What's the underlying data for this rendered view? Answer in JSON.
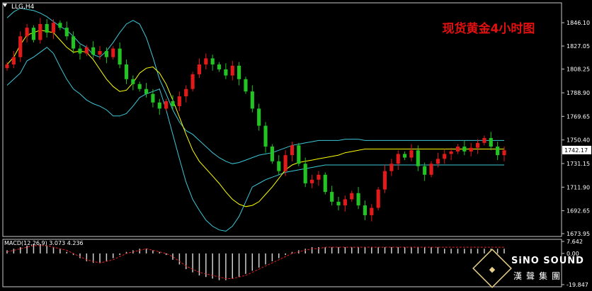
{
  "symbol_label": "LLG,H4",
  "chart_title": "现货黄金4小时图",
  "current_price": "1742.17",
  "indicator_label": "MACD(12,26,9) 3.073 4.236",
  "watermark": {
    "brand": "SiNO SOUND",
    "sub": "漢聲集團"
  },
  "colors": {
    "background": "#000000",
    "up_candle": "#e21a1a",
    "down_candle": "#22c322",
    "bands": "#3cc7d8",
    "middle_line": "#ffff00",
    "macd_hist": "#d0d0d0",
    "macd_signal": "#e02020",
    "title": "#e01010"
  },
  "chart_data": [
    {
      "type": "candlestick",
      "title": "现货黄金4小时图",
      "ylim": [
        1673.95,
        1860.0
      ],
      "y_ticks": [
        "1846.10",
        "1827.05",
        "1808.25",
        "1788.90",
        "1769.65",
        "1750.40",
        "1731.15",
        "1711.90",
        "1692.65",
        "1673.95"
      ],
      "last_price": 1742.17,
      "series": [
        {
          "name": "close",
          "values": [
            1812,
            1818,
            1835,
            1842,
            1832,
            1845,
            1838,
            1846,
            1842,
            1835,
            1825,
            1821,
            1826,
            1820,
            1823,
            1818,
            1825,
            1812,
            1800,
            1796,
            1792,
            1788,
            1781,
            1776,
            1782,
            1778,
            1786,
            1792,
            1804,
            1812,
            1817,
            1812,
            1808,
            1803,
            1811,
            1800,
            1790,
            1776,
            1762,
            1745,
            1733,
            1725,
            1738,
            1746,
            1731,
            1715,
            1718,
            1722,
            1708,
            1700,
            1697,
            1702,
            1707,
            1697,
            1689,
            1695,
            1710,
            1725,
            1731,
            1739,
            1736,
            1742,
            1729,
            1722,
            1731,
            1735,
            1739,
            1741,
            1745,
            1741,
            1744,
            1748,
            1752,
            1745,
            1738,
            1742
          ]
        },
        {
          "name": "bb_upper",
          "values": [
            1850,
            1855,
            1858,
            1857,
            1856,
            1854,
            1851,
            1847,
            1843,
            1840,
            1835,
            1829,
            1826,
            1820,
            1818,
            1823,
            1830,
            1838,
            1845,
            1848,
            1845,
            1834,
            1818,
            1800,
            1788,
            1775,
            1765,
            1758,
            1755,
            1750,
            1745,
            1740,
            1736,
            1733,
            1731,
            1732,
            1734,
            1736,
            1738,
            1739,
            1740,
            1742,
            1744,
            1746,
            1747,
            1748,
            1749,
            1750,
            1750,
            1750,
            1750,
            1751,
            1751,
            1751,
            1750,
            1750,
            1750,
            1750,
            1750,
            1750,
            1750,
            1750,
            1750,
            1750,
            1750,
            1750,
            1750,
            1750,
            1750,
            1750,
            1750,
            1750,
            1750,
            1750,
            1750,
            1750
          ]
        },
        {
          "name": "bb_middle",
          "values": [
            1812,
            1818,
            1828,
            1836,
            1838,
            1840,
            1839,
            1838,
            1832,
            1826,
            1822,
            1823,
            1822,
            1816,
            1808,
            1800,
            1794,
            1790,
            1791,
            1797,
            1805,
            1809,
            1810,
            1805,
            1796,
            1783,
            1769,
            1755,
            1742,
            1733,
            1727,
            1721,
            1715,
            1708,
            1702,
            1698,
            1696,
            1697,
            1700,
            1706,
            1712,
            1719,
            1726,
            1730,
            1732,
            1733,
            1734,
            1735,
            1736,
            1737,
            1738,
            1740,
            1741,
            1742,
            1743,
            1743,
            1743,
            1743,
            1743,
            1743,
            1743,
            1743,
            1743,
            1743,
            1743,
            1743,
            1743,
            1743,
            1743,
            1743,
            1743,
            1743,
            1743,
            1743,
            1743,
            1743
          ]
        },
        {
          "name": "bb_lower",
          "values": [
            1795,
            1800,
            1805,
            1815,
            1818,
            1822,
            1826,
            1821,
            1810,
            1800,
            1792,
            1788,
            1783,
            1780,
            1778,
            1775,
            1770,
            1770,
            1772,
            1778,
            1785,
            1788,
            1790,
            1792,
            1775,
            1755,
            1735,
            1716,
            1702,
            1693,
            1685,
            1680,
            1677,
            1676,
            1680,
            1688,
            1700,
            1712,
            1715,
            1718,
            1720,
            1722,
            1724,
            1725,
            1726,
            1727,
            1728,
            1729,
            1730,
            1730,
            1730,
            1730,
            1730,
            1730,
            1730,
            1730,
            1730,
            1730,
            1730,
            1730,
            1730,
            1730,
            1730,
            1730,
            1730,
            1730,
            1730,
            1730,
            1730,
            1730,
            1730,
            1730,
            1730,
            1730,
            1730,
            1730
          ]
        }
      ]
    },
    {
      "type": "bar",
      "title": "MACD(12,26,9) 3.073 4.236",
      "ylim": [
        -19.847,
        7.642
      ],
      "y_ticks": [
        "7.642",
        "0.00",
        "-19.847"
      ],
      "series": [
        {
          "name": "macd",
          "values": [
            2,
            3,
            4,
            5,
            6,
            6,
            5,
            4,
            3,
            1,
            -1,
            -3,
            -5,
            -6,
            -6,
            -5,
            -3,
            -1,
            1,
            2,
            3,
            3,
            2,
            1,
            -1,
            -4,
            -7,
            -10,
            -12,
            -14,
            -15,
            -16,
            -17,
            -17,
            -16,
            -15,
            -13,
            -11,
            -9,
            -7,
            -5,
            -3,
            -1,
            1,
            2,
            3,
            4,
            4,
            4,
            4,
            4,
            4,
            4,
            4,
            4,
            4,
            4,
            4,
            4,
            4,
            4,
            4,
            4,
            4,
            4,
            4,
            3,
            3,
            3,
            3,
            3,
            3,
            3,
            3,
            3,
            3
          ]
        },
        {
          "name": "signal",
          "values": [
            1,
            2,
            3,
            4,
            5,
            5,
            5,
            4,
            3,
            2,
            0,
            -2,
            -4,
            -5,
            -6,
            -5,
            -4,
            -2,
            0,
            1,
            2,
            3,
            2,
            1,
            0,
            -2,
            -5,
            -8,
            -10,
            -12,
            -13,
            -14,
            -15,
            -16,
            -16,
            -15,
            -14,
            -12,
            -10,
            -8,
            -6,
            -4,
            -2,
            0,
            1,
            2,
            3,
            3,
            4,
            4,
            4,
            4,
            4,
            4,
            4,
            4,
            4,
            4,
            4,
            4,
            4,
            4,
            4,
            4,
            4,
            4,
            4,
            4,
            4,
            4,
            4,
            4,
            4,
            4,
            4,
            4
          ]
        }
      ]
    }
  ]
}
